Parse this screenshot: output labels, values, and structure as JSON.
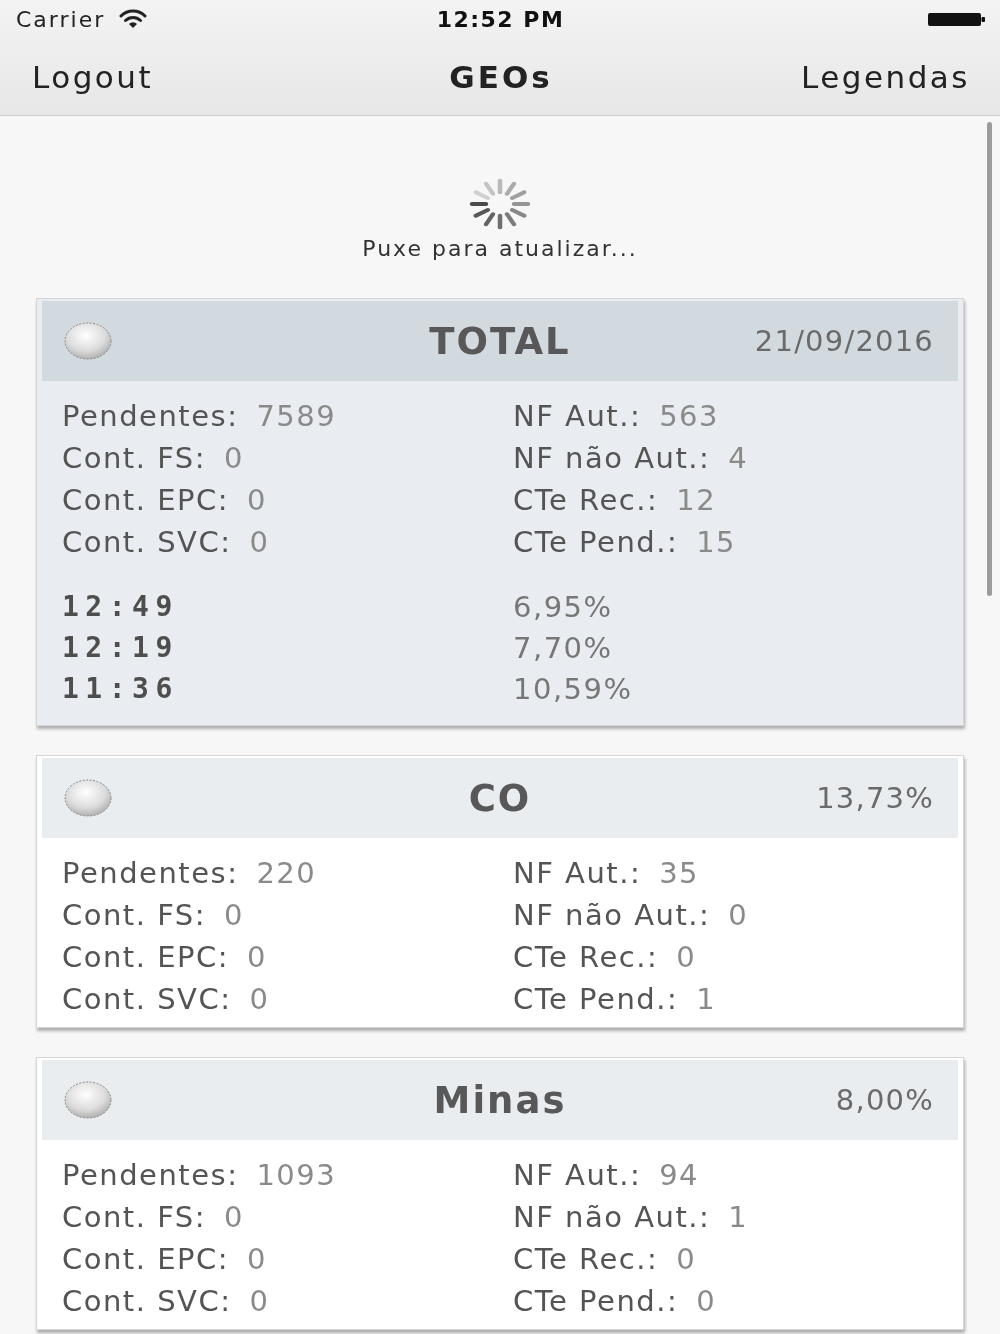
{
  "status_bar": {
    "carrier": "Carrier",
    "time": "12:52 PM"
  },
  "nav_bar": {
    "left_button": "Logout",
    "title": "GEOs",
    "right_button": "Legendas"
  },
  "refresh": {
    "label": "Puxe para atualizar..."
  },
  "cards": [
    {
      "kind": "total",
      "title": "TOTAL",
      "corner": "21/09/2016",
      "stats_left": [
        {
          "label": "Pendentes:",
          "value": "7589"
        },
        {
          "label": "Cont. FS:",
          "value": "0"
        },
        {
          "label": "Cont. EPC:",
          "value": "0"
        },
        {
          "label": "Cont. SVC:",
          "value": "0"
        }
      ],
      "stats_right": [
        {
          "label": "NF Aut.:",
          "value": "563"
        },
        {
          "label": "NF não Aut.:",
          "value": "4"
        },
        {
          "label": "CTe Rec.:",
          "value": "12"
        },
        {
          "label": "CTe Pend.:",
          "value": "15"
        }
      ],
      "history": [
        {
          "time": "12:49",
          "percent": "6,95%"
        },
        {
          "time": "12:19",
          "percent": "7,70%"
        },
        {
          "time": "11:36",
          "percent": "10,59%"
        }
      ]
    },
    {
      "kind": "region",
      "title": "CO",
      "corner": "13,73%",
      "stats_left": [
        {
          "label": "Pendentes:",
          "value": "220"
        },
        {
          "label": "Cont. FS:",
          "value": "0"
        },
        {
          "label": "Cont. EPC:",
          "value": "0"
        },
        {
          "label": "Cont. SVC:",
          "value": "0"
        }
      ],
      "stats_right": [
        {
          "label": "NF Aut.:",
          "value": "35"
        },
        {
          "label": "NF não Aut.:",
          "value": "0"
        },
        {
          "label": "CTe Rec.:",
          "value": "0"
        },
        {
          "label": "CTe Pend.:",
          "value": "1"
        }
      ]
    },
    {
      "kind": "region",
      "title": "Minas",
      "corner": "8,00%",
      "stats_left": [
        {
          "label": "Pendentes:",
          "value": "1093"
        },
        {
          "label": "Cont. FS:",
          "value": "0"
        },
        {
          "label": "Cont. EPC:",
          "value": "0"
        },
        {
          "label": "Cont. SVC:",
          "value": "0"
        }
      ],
      "stats_right": [
        {
          "label": "NF Aut.:",
          "value": "94"
        },
        {
          "label": "NF não Aut.:",
          "value": "1"
        },
        {
          "label": "CTe Rec.:",
          "value": "0"
        },
        {
          "label": "CTe Pend.:",
          "value": "0"
        }
      ]
    }
  ]
}
